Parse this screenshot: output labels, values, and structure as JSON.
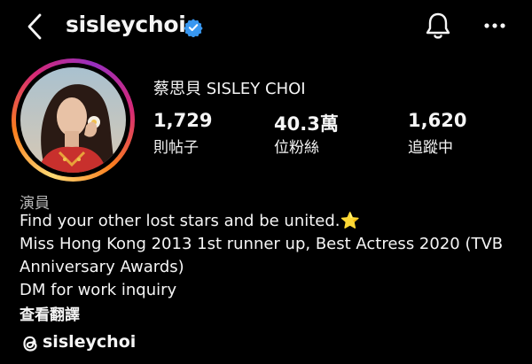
{
  "header": {
    "username": "sisleychoi"
  },
  "profile": {
    "display_name": "蔡思貝 SISLEY CHOI",
    "stats": [
      {
        "value": "1,729",
        "label": "則帖子"
      },
      {
        "value": "40.3萬",
        "label": "位粉絲"
      },
      {
        "value": "1,620",
        "label": "追蹤中"
      }
    ],
    "category": "演員",
    "bio_lines": [
      "Find your other lost stars and be united.⭐",
      "Miss Hong Kong 2013 1st runner up, Best Actress 2020 (TVB",
      "Anniversary Awards)",
      "DM for work inquiry"
    ],
    "translate_label": "查看翻譯",
    "threads_handle": "sisleychoi"
  },
  "icons": {
    "back": "back-arrow-icon",
    "verified": "verified-badge-icon",
    "bell": "notification-bell-icon",
    "more": "more-options-icon",
    "threads": "threads-icon"
  },
  "colors": {
    "background": "#000000",
    "text": "#f5f5f5",
    "verified": "#3897f0",
    "category": "#b5b5b5"
  }
}
